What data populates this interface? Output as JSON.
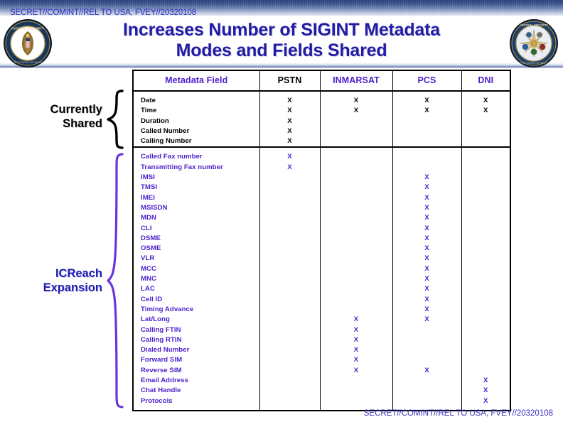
{
  "classification": {
    "top": "SECRET//COMINT//REL TO USA, FVEY//20320108",
    "bottom": "SECRET//COMINT//REL TO USA, FVEY//20320108"
  },
  "title": {
    "line1": "Increases Number of SIGINT Metadata",
    "line2": "Modes and Fields Shared"
  },
  "seals": {
    "left": "nsa-seal",
    "right": "central-security-service-seal"
  },
  "groups": {
    "shared": {
      "line1": "Currently",
      "line2": "Shared",
      "color": "#000000"
    },
    "icreach": {
      "line1": "ICReach",
      "line2": "Expansion",
      "color": "#1b1bb5"
    }
  },
  "colors": {
    "purple": "#4a1fcc",
    "black": "#000000",
    "title_blue": "#221ba8",
    "banner_blue": "#223a77"
  },
  "table": {
    "columns": [
      "Metadata Field",
      "PSTN",
      "INMARSAT",
      "PCS",
      "DNI"
    ],
    "mark": "X",
    "sections": [
      {
        "name": "Currently Shared",
        "rows": [
          {
            "field": "Date",
            "PSTN": "X",
            "INMARSAT": "X",
            "PCS": "X",
            "DNI": "X"
          },
          {
            "field": "Time",
            "PSTN": "X",
            "INMARSAT": "X",
            "PCS": "X",
            "DNI": "X"
          },
          {
            "field": "Duration",
            "PSTN": "X",
            "INMARSAT": "",
            "PCS": "",
            "DNI": ""
          },
          {
            "field": "Called Number",
            "PSTN": "X",
            "INMARSAT": "",
            "PCS": "",
            "DNI": ""
          },
          {
            "field": "Calling Number",
            "PSTN": "X",
            "INMARSAT": "",
            "PCS": "",
            "DNI": ""
          }
        ]
      },
      {
        "name": "ICReach Expansion",
        "rows": [
          {
            "field": "Called Fax number",
            "PSTN": "X",
            "INMARSAT": "",
            "PCS": "",
            "DNI": ""
          },
          {
            "field": "Transmitting Fax number",
            "PSTN": "X",
            "INMARSAT": "",
            "PCS": "",
            "DNI": ""
          },
          {
            "field": "IMSI",
            "PSTN": "",
            "INMARSAT": "",
            "PCS": "X",
            "DNI": ""
          },
          {
            "field": "TMSI",
            "PSTN": "",
            "INMARSAT": "",
            "PCS": "X",
            "DNI": ""
          },
          {
            "field": "IMEI",
            "PSTN": "",
            "INMARSAT": "",
            "PCS": "X",
            "DNI": ""
          },
          {
            "field": "MSISDN",
            "PSTN": "",
            "INMARSAT": "",
            "PCS": "X",
            "DNI": ""
          },
          {
            "field": "MDN",
            "PSTN": "",
            "INMARSAT": "",
            "PCS": "X",
            "DNI": ""
          },
          {
            "field": "CLI",
            "PSTN": "",
            "INMARSAT": "",
            "PCS": "X",
            "DNI": ""
          },
          {
            "field": "DSME",
            "PSTN": "",
            "INMARSAT": "",
            "PCS": "X",
            "DNI": ""
          },
          {
            "field": "OSME",
            "PSTN": "",
            "INMARSAT": "",
            "PCS": "X",
            "DNI": ""
          },
          {
            "field": "VLR",
            "PSTN": "",
            "INMARSAT": "",
            "PCS": "X",
            "DNI": ""
          },
          {
            "field": "MCC",
            "PSTN": "",
            "INMARSAT": "",
            "PCS": "X",
            "DNI": ""
          },
          {
            "field": "MNC",
            "PSTN": "",
            "INMARSAT": "",
            "PCS": "X",
            "DNI": ""
          },
          {
            "field": "LAC",
            "PSTN": "",
            "INMARSAT": "",
            "PCS": "X",
            "DNI": ""
          },
          {
            "field": "Cell ID",
            "PSTN": "",
            "INMARSAT": "",
            "PCS": "X",
            "DNI": ""
          },
          {
            "field": "Timing Advance",
            "PSTN": "",
            "INMARSAT": "",
            "PCS": "X",
            "DNI": ""
          },
          {
            "field": "Lat/Long",
            "PSTN": "",
            "INMARSAT": "X",
            "PCS": "X",
            "DNI": ""
          },
          {
            "field": "Calling FTIN",
            "PSTN": "",
            "INMARSAT": "X",
            "PCS": "",
            "DNI": ""
          },
          {
            "field": "Calling RTIN",
            "PSTN": "",
            "INMARSAT": "X",
            "PCS": "",
            "DNI": ""
          },
          {
            "field": "Dialed Number",
            "PSTN": "",
            "INMARSAT": "X",
            "PCS": "",
            "DNI": ""
          },
          {
            "field": "Forward SIM",
            "PSTN": "",
            "INMARSAT": "X",
            "PCS": "",
            "DNI": ""
          },
          {
            "field": "Reverse SIM",
            "PSTN": "",
            "INMARSAT": "X",
            "PCS": "X",
            "DNI": ""
          },
          {
            "field": "Email Address",
            "PSTN": "",
            "INMARSAT": "",
            "PCS": "",
            "DNI": "X"
          },
          {
            "field": "Chat Handle",
            "PSTN": "",
            "INMARSAT": "",
            "PCS": "",
            "DNI": "X"
          },
          {
            "field": "Protocols",
            "PSTN": "",
            "INMARSAT": "",
            "PCS": "",
            "DNI": "X"
          }
        ]
      }
    ]
  }
}
